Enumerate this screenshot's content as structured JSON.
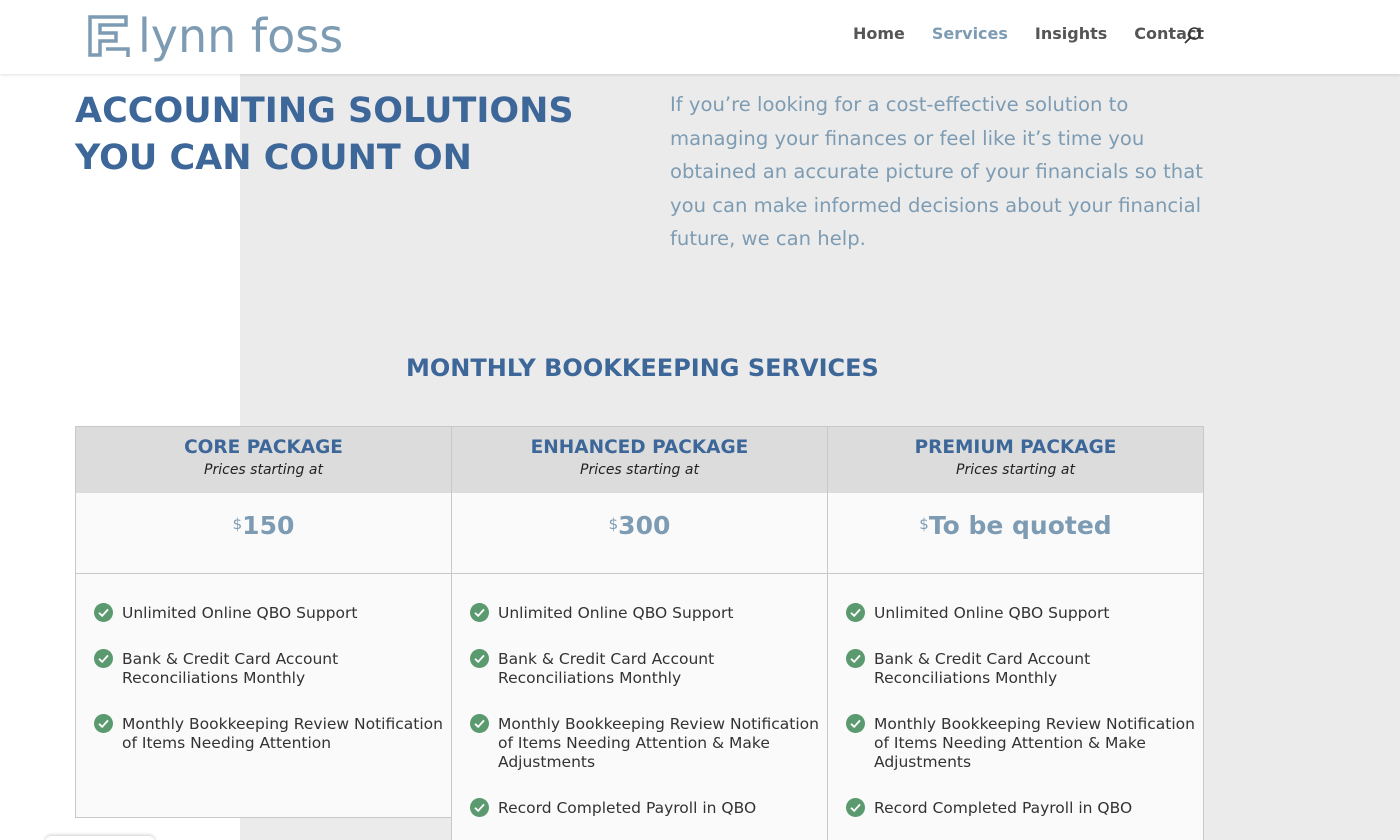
{
  "brand": {
    "logo_text": "lynn foss",
    "logo_mark": "LF monogram",
    "accent_color": "#7d9cb3",
    "heading_color": "#3d6799",
    "check_color": "#5a9a6e"
  },
  "nav": {
    "items": [
      {
        "label": "Home",
        "active": false
      },
      {
        "label": "Services",
        "active": true
      },
      {
        "label": "Insights",
        "active": false
      },
      {
        "label": "Contact",
        "active": false
      }
    ],
    "search_icon": "search-icon"
  },
  "hero": {
    "title_line1": "ACCOUNTING SOLUTIONS",
    "title_line2": "YOU CAN COUNT ON",
    "text": "If you’re looking for a cost-effective solution to managing your finances or feel like it’s time you obtained an accurate picture of your financials so that you can make informed decisions about your financial future, we can help."
  },
  "section": {
    "title": "MONTHLY BOOKKEEPING SERVICES"
  },
  "packages": [
    {
      "name": "CORE PACKAGE",
      "subtitle": "Prices starting at",
      "currency": "$",
      "price": "150",
      "features": [
        "Unlimited Online QBO Support",
        "Bank & Credit Card Account Reconciliations Monthly",
        "Monthly Bookkeeping Review Notification of Items Needing Attention"
      ]
    },
    {
      "name": "ENHANCED PACKAGE",
      "subtitle": "Prices starting at",
      "currency": "$",
      "price": "300",
      "features": [
        "Unlimited Online QBO Support",
        "Bank & Credit Card Account Reconciliations Monthly",
        "Monthly Bookkeeping Review Notification of Items Needing Attention & Make Adjustments",
        "Record Completed Payroll in QBO"
      ]
    },
    {
      "name": "PREMIUM PACKAGE",
      "subtitle": "Prices starting at",
      "currency": "$",
      "price": "To be quoted",
      "features": [
        "Unlimited Online QBO Support",
        "Bank & Credit Card Account Reconciliations Monthly",
        "Monthly Bookkeeping Review Notification of Items Needing Attention & Make Adjustments",
        "Record Completed Payroll in QBO"
      ]
    }
  ]
}
